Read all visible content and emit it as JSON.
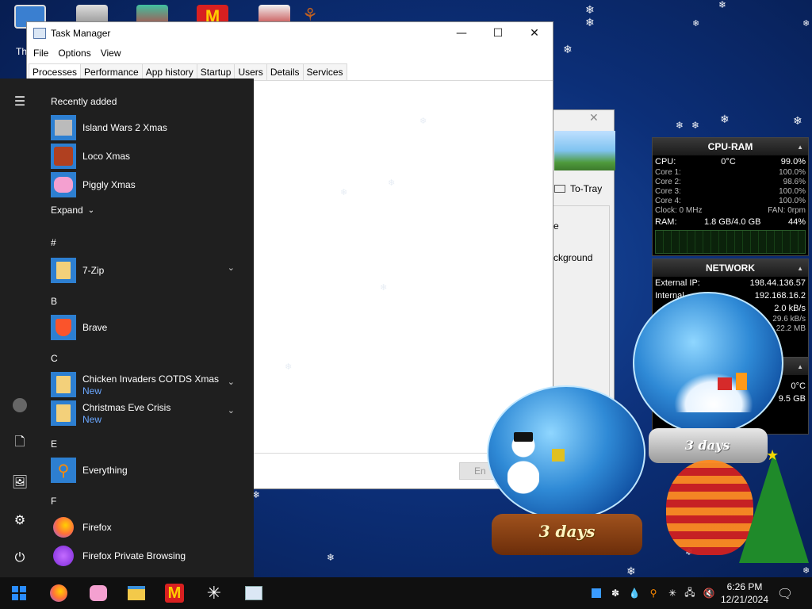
{
  "taskmgr": {
    "title": "Task Manager",
    "menu": [
      "File",
      "Options",
      "View"
    ],
    "tabs": [
      "Processes",
      "Performance",
      "App history",
      "Startup",
      "Users",
      "Details",
      "Services"
    ],
    "end_task": "En"
  },
  "bgwin": {
    "to_tray": "To-Tray",
    "frag1": "e",
    "frag2": "ckground"
  },
  "start": {
    "recently_added": "Recently added",
    "expand": "Expand",
    "sections": [
      "#",
      "B",
      "C",
      "E",
      "F"
    ],
    "items": [
      {
        "label": "Island Wars 2 Xmas"
      },
      {
        "label": "Loco Xmas"
      },
      {
        "label": "Piggly Xmas"
      },
      {
        "label": "7-Zip"
      },
      {
        "label": "Brave"
      },
      {
        "label": "Chicken Invaders COTDS Xmas",
        "sub": "New"
      },
      {
        "label": "Christmas Eve Crisis",
        "sub": "New"
      },
      {
        "label": "Everything"
      },
      {
        "label": "Firefox"
      },
      {
        "label": "Firefox Private Browsing"
      }
    ]
  },
  "cpu_widget": {
    "title": "CPU-RAM",
    "cpu_label": "CPU:",
    "cpu_temp": "0°C",
    "cpu_pct": "99.0%",
    "cores": [
      {
        "name": "Core 1:",
        "val": "100.0%"
      },
      {
        "name": "Core 2:",
        "val": "98.6%"
      },
      {
        "name": "Core 3:",
        "val": "100.0%"
      },
      {
        "name": "Core 4:",
        "val": "100.0%"
      }
    ],
    "clock": "Clock: 0 MHz",
    "fan": "FAN: 0rpm",
    "ram_label": "RAM:",
    "ram_val": "1.8 GB/4.0 GB",
    "ram_pct": "44%"
  },
  "net_widget": {
    "title": "NETWORK",
    "ext_label": "External IP:",
    "ext_ip": "198.44.136.57",
    "int_label": "Internal",
    "int_ip": "192.168.16.2",
    "speed": "2.0 kB/s",
    "up": "29.6 kB/s",
    "total": "22.2 MB"
  },
  "third_widget": {
    "temp": "0°C",
    "size": "9.5 GB"
  },
  "globes": {
    "left_days": "3 days",
    "right_days": "3 days"
  },
  "taskbar": {
    "time": "6:26 PM",
    "date": "12/21/2024"
  },
  "desktop": {
    "icon_label": "Th"
  }
}
